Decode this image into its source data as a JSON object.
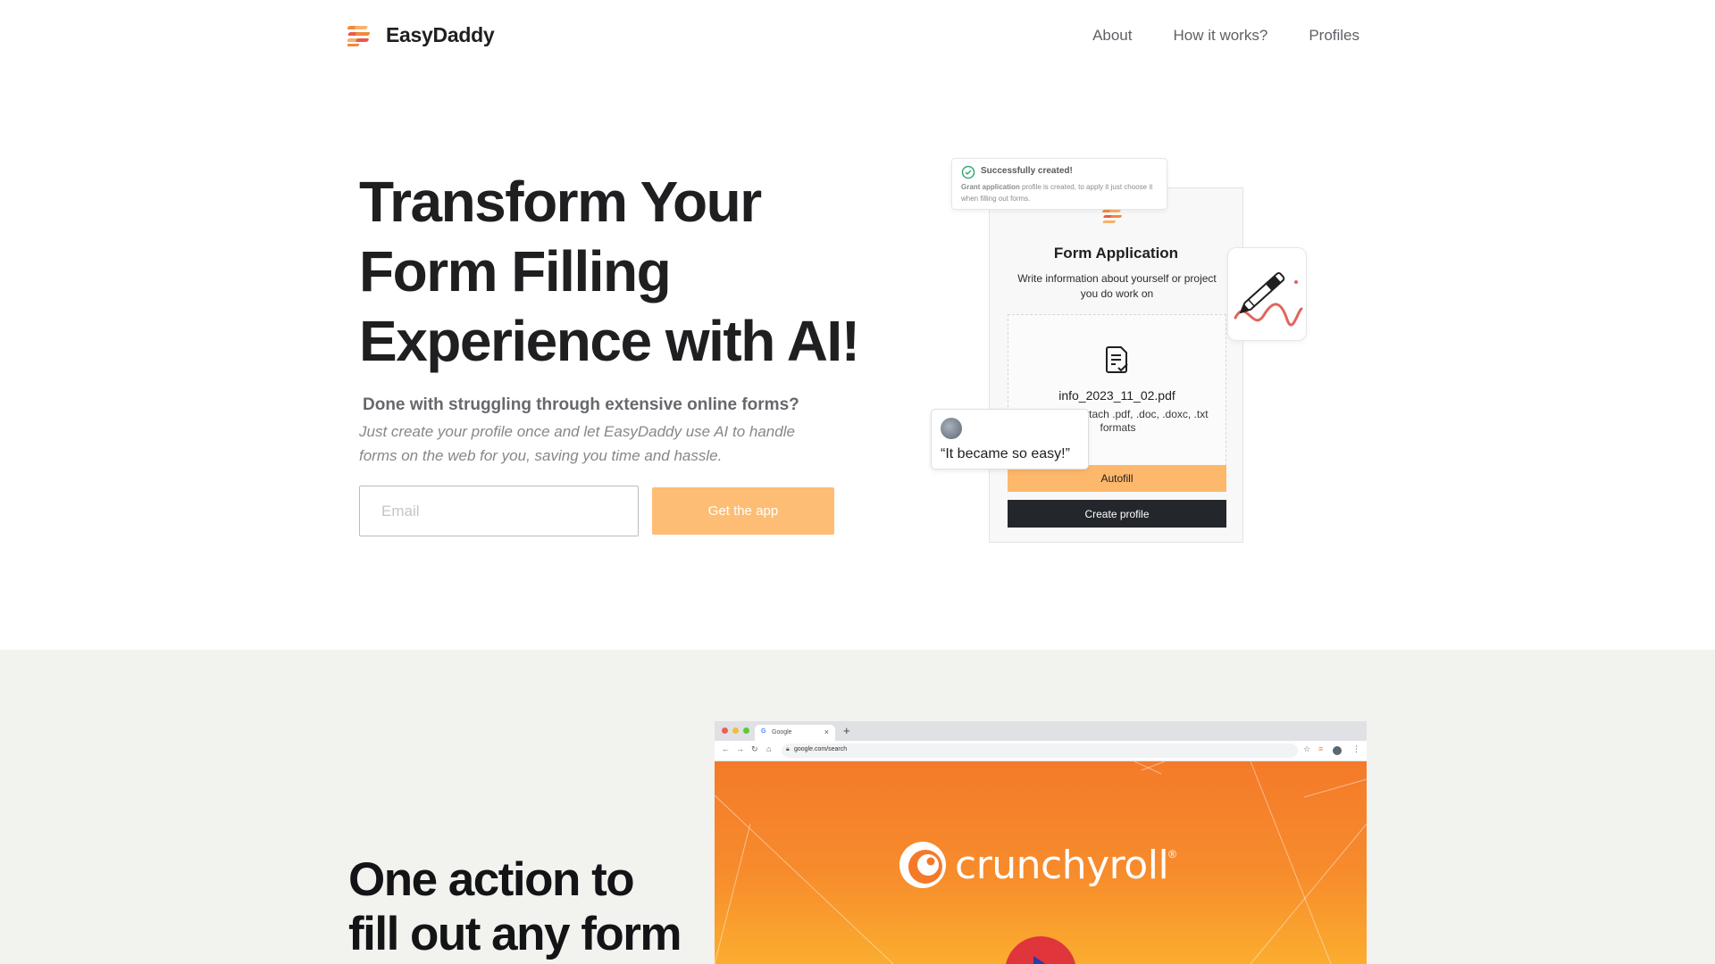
{
  "nav": {
    "brand": "EasyDaddy",
    "links": [
      "About",
      "How it works?",
      "Profiles"
    ]
  },
  "hero": {
    "title_lines": [
      "Transform Your",
      "Form Filling",
      "Experience with AI!"
    ],
    "subtitle": "Done with struggling through extensive online forms?",
    "description": "Just create your profile once and let EasyDaddy use AI to handle forms on the web for you, saving you time and hassle.",
    "email_placeholder": "Email",
    "cta_label": "Get the app"
  },
  "illustration": {
    "toast_title": "Successfully created!",
    "toast_text_bold": "Grant application",
    "toast_text": " profile is created, to apply it just choose it when filling out forms.",
    "form_title": "Form Application",
    "form_desc": "Write information about yourself or project you do work on",
    "file_name": "info_2023_11_02.pdf",
    "file_hint": "Allowed to attach .pdf, .doc, .doxc, .txt formats",
    "autofill_label": "Autofill",
    "create_label": "Create profile",
    "review_text": "“It became so easy!”"
  },
  "section2": {
    "title_lines": [
      "One action to",
      "fill out any form"
    ],
    "browser": {
      "tab_label": "Google",
      "tab_icon": "G",
      "url": "google.com/search",
      "video_brand": "crunchyroll",
      "registered_mark": "®"
    }
  },
  "colors": {
    "accent": "#fdbd74",
    "autofill": "#fdb86b",
    "dark_button": "#23262b",
    "section_bg": "#f2f2ef",
    "crunchyroll_orange": "#f47a2a",
    "play_button": "#e0353b"
  },
  "icons": {
    "logo": "easydaddy-stripes-icon",
    "toast": "check-circle-icon",
    "document": "document-check-icon",
    "pen": "pen-signature-icon",
    "lock": "lock-icon",
    "play": "play-icon"
  }
}
